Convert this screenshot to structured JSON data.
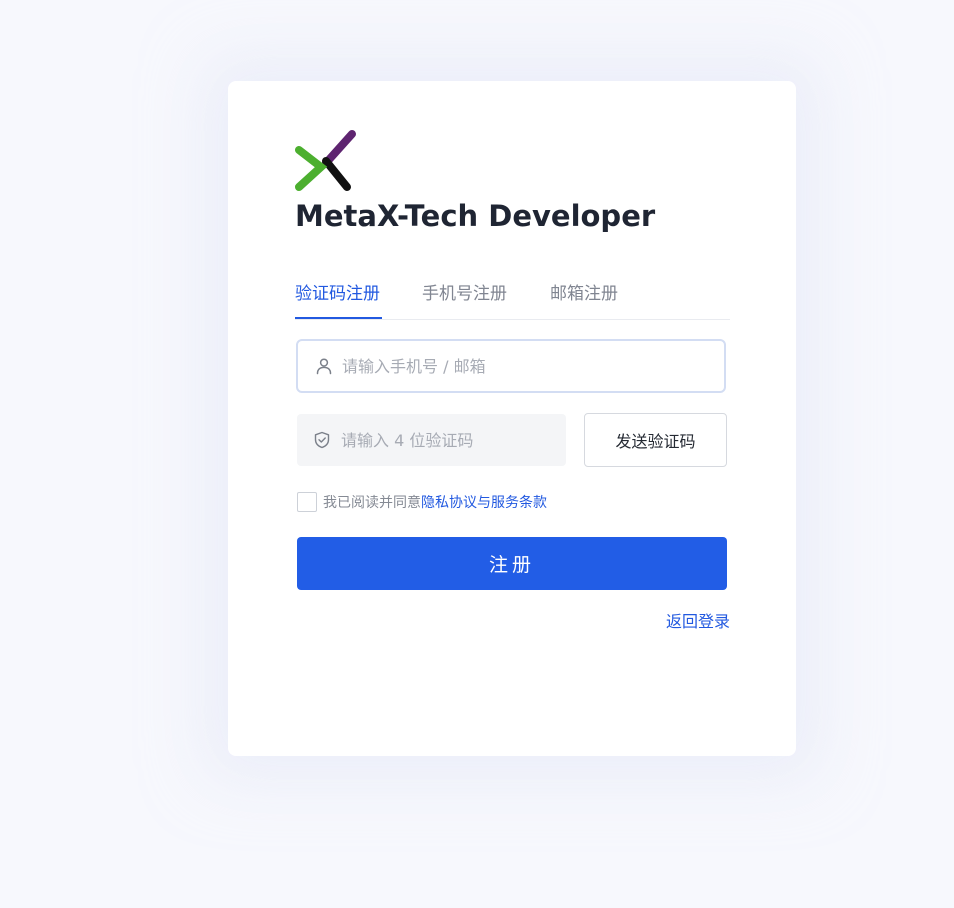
{
  "brand": {
    "logo_icon": "metax-x-logo-icon",
    "title": "MetaX-Tech Developer"
  },
  "tabs": [
    {
      "label": "验证码注册",
      "active": true
    },
    {
      "label": "手机号注册",
      "active": false
    },
    {
      "label": "邮箱注册",
      "active": false
    }
  ],
  "form": {
    "account": {
      "icon": "user-icon",
      "value": "",
      "placeholder": "请输入手机号 / 邮箱"
    },
    "code": {
      "icon": "shield-check-icon",
      "value": "",
      "placeholder": "请输入 4 位验证码"
    },
    "send_code_label": "发送验证码",
    "agreement": {
      "checked": false,
      "prefix": "我已阅读并同意",
      "link_label": "隐私协议与服务条款"
    },
    "submit_label": "注册",
    "back_login_label": "返回登录"
  },
  "colors": {
    "accent": "#225de6",
    "page_background": "#f7f8fd",
    "logo_green": "#4caf2f",
    "logo_purple": "#5e2470",
    "logo_black": "#111111"
  }
}
